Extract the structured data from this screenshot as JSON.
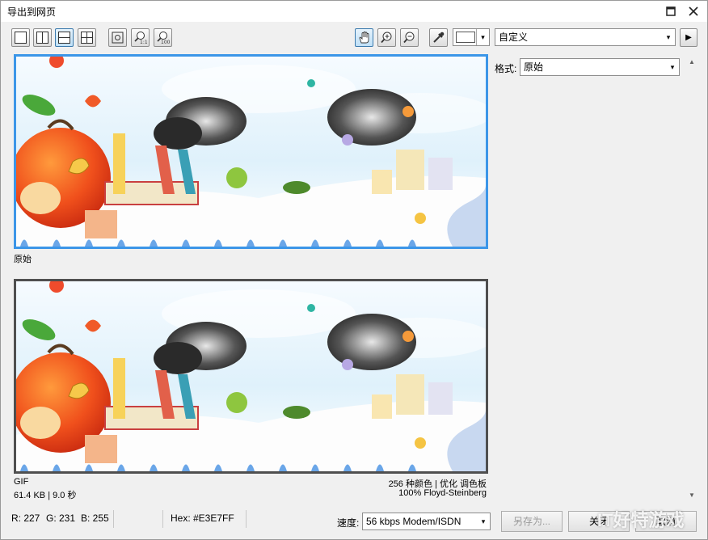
{
  "window": {
    "title": "导出到网页"
  },
  "toolbar": {
    "preset_value": "自定义",
    "preset_arrow": "▾",
    "swatch_arrow": "▾",
    "next_arrow": "▶"
  },
  "right_panel": {
    "format_label": "格式:",
    "format_value": "原始"
  },
  "preview_top": {
    "label": "原始"
  },
  "preview_bottom": {
    "format": "GIF",
    "size_time": "61.4 KB  |  9.0 秒",
    "colors_info": "256 种颜色  |  优化 调色板",
    "dither_info": "100% Floyd-Steinberg"
  },
  "status": {
    "r": "R: 227",
    "g": "G: 231",
    "b": "B: 255",
    "hex": "Hex: #E3E7FF",
    "speed_label": "速度:",
    "speed_value": "56 kbps Modem/ISDN"
  },
  "buttons": {
    "save_as": "另存为...",
    "close": "关闭",
    "cancel": "取消"
  },
  "watermark": "IT好特游戏"
}
